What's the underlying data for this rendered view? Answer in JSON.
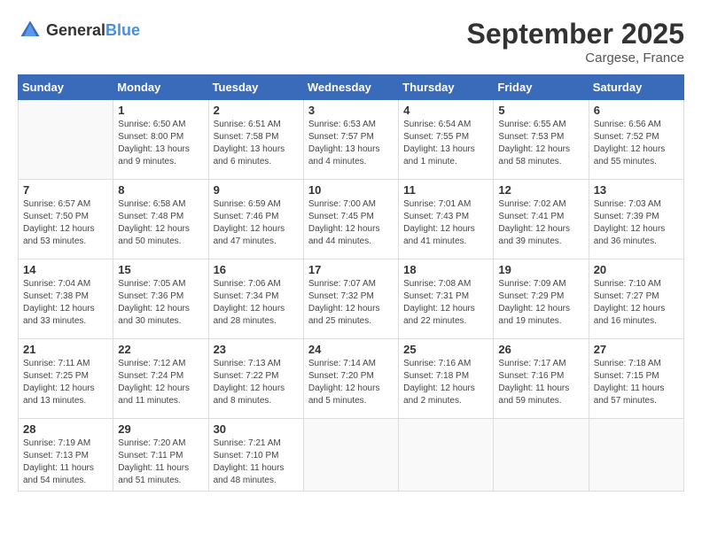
{
  "header": {
    "logo": {
      "general": "General",
      "blue": "Blue"
    },
    "title": "September 2025",
    "location": "Cargese, France"
  },
  "days_of_week": [
    "Sunday",
    "Monday",
    "Tuesday",
    "Wednesday",
    "Thursday",
    "Friday",
    "Saturday"
  ],
  "weeks": [
    [
      {
        "day": "",
        "info": ""
      },
      {
        "day": "1",
        "info": "Sunrise: 6:50 AM\nSunset: 8:00 PM\nDaylight: 13 hours\nand 9 minutes."
      },
      {
        "day": "2",
        "info": "Sunrise: 6:51 AM\nSunset: 7:58 PM\nDaylight: 13 hours\nand 6 minutes."
      },
      {
        "day": "3",
        "info": "Sunrise: 6:53 AM\nSunset: 7:57 PM\nDaylight: 13 hours\nand 4 minutes."
      },
      {
        "day": "4",
        "info": "Sunrise: 6:54 AM\nSunset: 7:55 PM\nDaylight: 13 hours\nand 1 minute."
      },
      {
        "day": "5",
        "info": "Sunrise: 6:55 AM\nSunset: 7:53 PM\nDaylight: 12 hours\nand 58 minutes."
      },
      {
        "day": "6",
        "info": "Sunrise: 6:56 AM\nSunset: 7:52 PM\nDaylight: 12 hours\nand 55 minutes."
      }
    ],
    [
      {
        "day": "7",
        "info": "Sunrise: 6:57 AM\nSunset: 7:50 PM\nDaylight: 12 hours\nand 53 minutes."
      },
      {
        "day": "8",
        "info": "Sunrise: 6:58 AM\nSunset: 7:48 PM\nDaylight: 12 hours\nand 50 minutes."
      },
      {
        "day": "9",
        "info": "Sunrise: 6:59 AM\nSunset: 7:46 PM\nDaylight: 12 hours\nand 47 minutes."
      },
      {
        "day": "10",
        "info": "Sunrise: 7:00 AM\nSunset: 7:45 PM\nDaylight: 12 hours\nand 44 minutes."
      },
      {
        "day": "11",
        "info": "Sunrise: 7:01 AM\nSunset: 7:43 PM\nDaylight: 12 hours\nand 41 minutes."
      },
      {
        "day": "12",
        "info": "Sunrise: 7:02 AM\nSunset: 7:41 PM\nDaylight: 12 hours\nand 39 minutes."
      },
      {
        "day": "13",
        "info": "Sunrise: 7:03 AM\nSunset: 7:39 PM\nDaylight: 12 hours\nand 36 minutes."
      }
    ],
    [
      {
        "day": "14",
        "info": "Sunrise: 7:04 AM\nSunset: 7:38 PM\nDaylight: 12 hours\nand 33 minutes."
      },
      {
        "day": "15",
        "info": "Sunrise: 7:05 AM\nSunset: 7:36 PM\nDaylight: 12 hours\nand 30 minutes."
      },
      {
        "day": "16",
        "info": "Sunrise: 7:06 AM\nSunset: 7:34 PM\nDaylight: 12 hours\nand 28 minutes."
      },
      {
        "day": "17",
        "info": "Sunrise: 7:07 AM\nSunset: 7:32 PM\nDaylight: 12 hours\nand 25 minutes."
      },
      {
        "day": "18",
        "info": "Sunrise: 7:08 AM\nSunset: 7:31 PM\nDaylight: 12 hours\nand 22 minutes."
      },
      {
        "day": "19",
        "info": "Sunrise: 7:09 AM\nSunset: 7:29 PM\nDaylight: 12 hours\nand 19 minutes."
      },
      {
        "day": "20",
        "info": "Sunrise: 7:10 AM\nSunset: 7:27 PM\nDaylight: 12 hours\nand 16 minutes."
      }
    ],
    [
      {
        "day": "21",
        "info": "Sunrise: 7:11 AM\nSunset: 7:25 PM\nDaylight: 12 hours\nand 13 minutes."
      },
      {
        "day": "22",
        "info": "Sunrise: 7:12 AM\nSunset: 7:24 PM\nDaylight: 12 hours\nand 11 minutes."
      },
      {
        "day": "23",
        "info": "Sunrise: 7:13 AM\nSunset: 7:22 PM\nDaylight: 12 hours\nand 8 minutes."
      },
      {
        "day": "24",
        "info": "Sunrise: 7:14 AM\nSunset: 7:20 PM\nDaylight: 12 hours\nand 5 minutes."
      },
      {
        "day": "25",
        "info": "Sunrise: 7:16 AM\nSunset: 7:18 PM\nDaylight: 12 hours\nand 2 minutes."
      },
      {
        "day": "26",
        "info": "Sunrise: 7:17 AM\nSunset: 7:16 PM\nDaylight: 11 hours\nand 59 minutes."
      },
      {
        "day": "27",
        "info": "Sunrise: 7:18 AM\nSunset: 7:15 PM\nDaylight: 11 hours\nand 57 minutes."
      }
    ],
    [
      {
        "day": "28",
        "info": "Sunrise: 7:19 AM\nSunset: 7:13 PM\nDaylight: 11 hours\nand 54 minutes."
      },
      {
        "day": "29",
        "info": "Sunrise: 7:20 AM\nSunset: 7:11 PM\nDaylight: 11 hours\nand 51 minutes."
      },
      {
        "day": "30",
        "info": "Sunrise: 7:21 AM\nSunset: 7:10 PM\nDaylight: 11 hours\nand 48 minutes."
      },
      {
        "day": "",
        "info": ""
      },
      {
        "day": "",
        "info": ""
      },
      {
        "day": "",
        "info": ""
      },
      {
        "day": "",
        "info": ""
      }
    ]
  ]
}
